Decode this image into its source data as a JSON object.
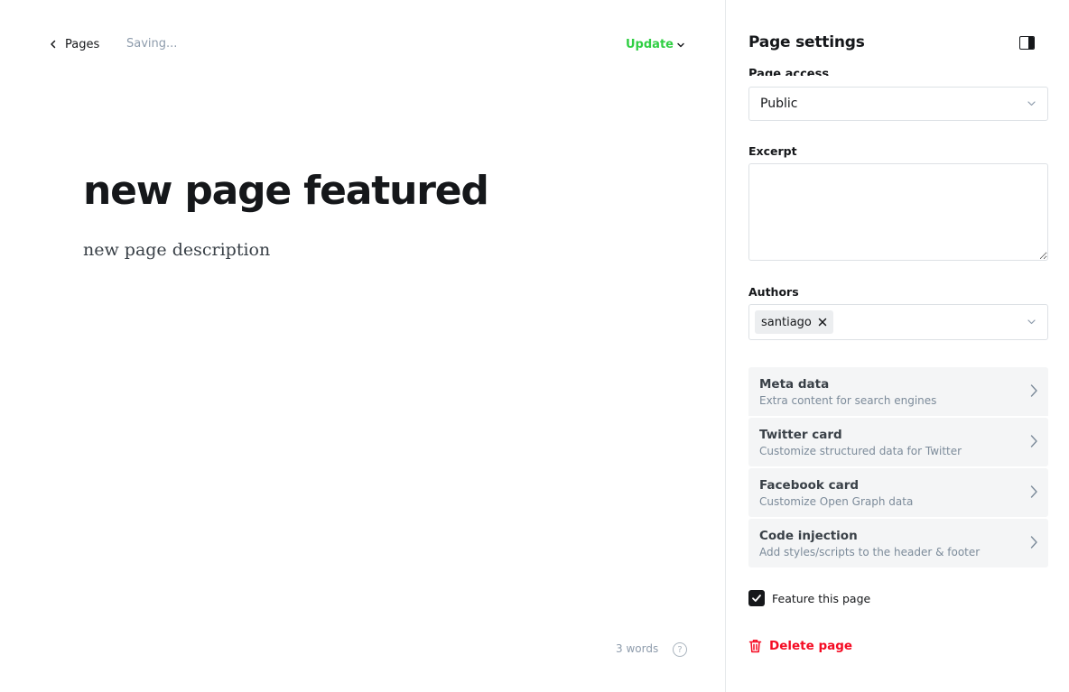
{
  "editor": {
    "back_label": "Pages",
    "status": "Saving...",
    "update_label": "Update",
    "title": "new page featured",
    "excerpt": "new page description",
    "word_count": "3 words",
    "help_glyph": "?"
  },
  "settings": {
    "title": "Page settings",
    "access_label": "Page access",
    "access_value": "Public",
    "excerpt_label": "Excerpt",
    "excerpt_value": "",
    "authors_label": "Authors",
    "authors": [
      "santiago"
    ],
    "menu": [
      {
        "title": "Meta data",
        "subtitle": "Extra content for search engines"
      },
      {
        "title": "Twitter card",
        "subtitle": "Customize structured data for Twitter"
      },
      {
        "title": "Facebook card",
        "subtitle": "Customize Open Graph data"
      },
      {
        "title": "Code injection",
        "subtitle": "Add styles/scripts to the header & footer"
      }
    ],
    "feature_label": "Feature this page",
    "feature_checked": true,
    "delete_label": "Delete page"
  },
  "colors": {
    "accent_green": "#30cf43",
    "danger_red": "#f50b23",
    "text_dark": "#15171a",
    "muted": "#8e9cac",
    "panel_bg": "#f4f5f6"
  },
  "icons": [
    "chevron-left-icon",
    "chevron-down-icon",
    "help-icon",
    "sidebar-toggle-icon",
    "close-icon",
    "chevron-right-icon",
    "checkmark-icon",
    "trash-icon"
  ]
}
